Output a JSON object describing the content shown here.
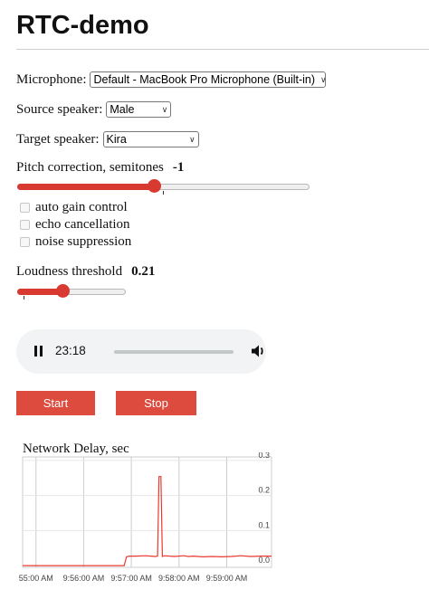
{
  "page": {
    "title": "RTC-demo"
  },
  "controls": {
    "microphone": {
      "label": "Microphone:",
      "selected": "Default - MacBook Pro Microphone (Built-in)"
    },
    "source_speaker": {
      "label": "Source speaker:",
      "selected": "Male"
    },
    "target_speaker": {
      "label": "Target speaker:",
      "selected": "Kira"
    },
    "pitch": {
      "label": "Pitch correction, semitones",
      "value": "-1",
      "fraction": 0.47
    },
    "checkboxes": [
      {
        "label": "auto gain control",
        "checked": false
      },
      {
        "label": "echo cancellation",
        "checked": false
      },
      {
        "label": "noise suppression",
        "checked": false
      }
    ],
    "loudness": {
      "label": "Loudness threshold",
      "value": "0.21",
      "fraction": 0.42
    }
  },
  "player": {
    "time": "23:18",
    "progress": 0.0,
    "playing": true
  },
  "buttons": {
    "start": "Start",
    "stop": "Stop"
  },
  "colors": {
    "accent": "#dc4b3e",
    "slider": "#d83a32",
    "series": "#e8392e"
  },
  "icons": {
    "pause": "pause-icon",
    "volume": "volume-icon",
    "chevron": "chevron-down-icon"
  },
  "chart_data": {
    "type": "line",
    "title": "Network Delay, sec",
    "xlabel": "",
    "ylabel": "",
    "x_tick_labels": [
      "55:00 AM",
      "9:56:00 AM",
      "9:57:00 AM",
      "9:58:00 AM",
      "9:59:00 AM"
    ],
    "x_tick_minutes": [
      55,
      56,
      57,
      58,
      59
    ],
    "xlim": [
      54.72,
      59.94
    ],
    "y_ticks": [
      0.0,
      0.1,
      0.2,
      0.3
    ],
    "y_tick_labels": [
      "0.0",
      "0.1",
      "0.2",
      "0.3"
    ],
    "ylim": [
      -0.005,
      0.31
    ],
    "grid": true,
    "legend": "none",
    "series": [
      {
        "x": [
          54.72,
          56.85,
          56.9,
          56.96,
          57.1,
          57.3,
          57.5,
          57.55,
          57.58,
          57.62,
          57.65,
          57.7,
          57.9,
          58.1,
          58.2,
          58.3,
          58.5,
          58.7,
          58.9,
          59.1,
          59.3,
          59.5,
          59.7,
          59.94
        ],
        "y": [
          0.0,
          0.0,
          0.025,
          0.027,
          0.027,
          0.028,
          0.026,
          0.027,
          0.254,
          0.254,
          0.026,
          0.028,
          0.026,
          0.028,
          0.026,
          0.027,
          0.025,
          0.026,
          0.025,
          0.026,
          0.028,
          0.026,
          0.027,
          0.027
        ]
      }
    ]
  }
}
